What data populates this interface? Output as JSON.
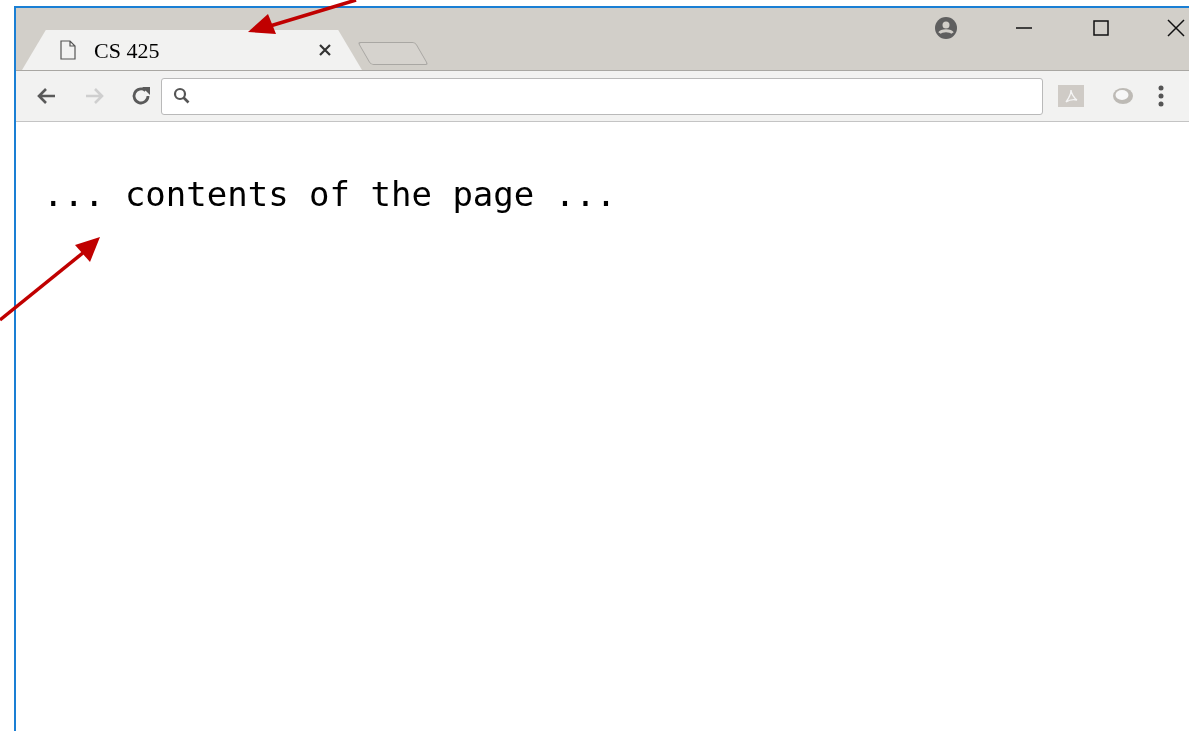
{
  "tabs": [
    {
      "title": "CS 425",
      "selected": true
    }
  ],
  "nav_buttons": [
    {
      "kind": "back",
      "disabled": false
    },
    {
      "kind": "forward",
      "disabled": true
    },
    {
      "kind": "reload",
      "disabled": false
    }
  ],
  "page": {
    "text": "... contents of the page ..."
  }
}
